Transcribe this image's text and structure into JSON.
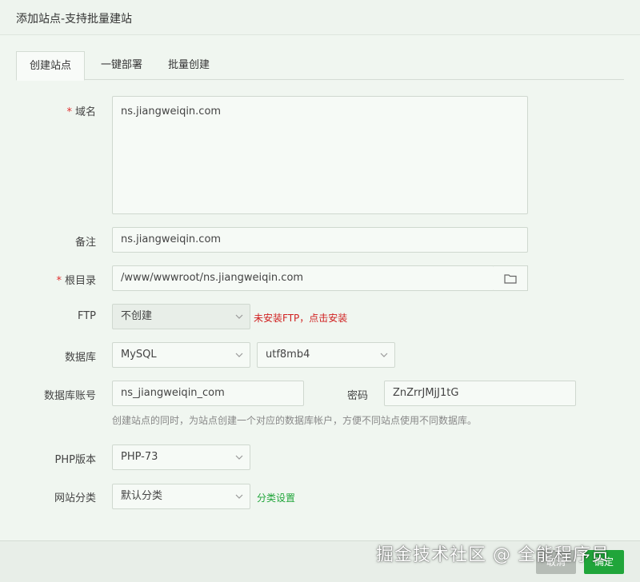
{
  "dialog": {
    "title": "添加站点-支持批量建站"
  },
  "tabs": [
    {
      "label": "创建站点",
      "active": true
    },
    {
      "label": "一键部署",
      "active": false
    },
    {
      "label": "批量创建",
      "active": false
    }
  ],
  "form": {
    "domain": {
      "label": "域名",
      "required": true,
      "value": "ns.jiangweiqin.com"
    },
    "remark": {
      "label": "备注",
      "value": "ns.jiangweiqin.com"
    },
    "root": {
      "label": "根目录",
      "required": true,
      "value": "/www/wwwroot/ns.jiangweiqin.com",
      "button_icon": "folder-icon"
    },
    "ftp": {
      "label": "FTP",
      "selected": "不创建",
      "link": "未安装FTP，点击安装"
    },
    "database": {
      "label": "数据库",
      "type": "MySQL",
      "charset": "utf8mb4"
    },
    "db_account": {
      "label": "数据库账号",
      "value": "ns_jiangweiqin_com"
    },
    "db_password": {
      "label": "密码",
      "value": "ZnZrrJMjJ1tG"
    },
    "db_hint": "创建站点的同时，为站点创建一个对应的数据库帐户，方便不同站点使用不同数据库。",
    "php": {
      "label": "PHP版本",
      "selected": "PHP-73"
    },
    "category": {
      "label": "网站分类",
      "selected": "默认分类",
      "link": "分类设置"
    }
  },
  "footer": {
    "cancel_label": "取消",
    "ok_label": "确定"
  },
  "watermark": "掘金技术社区 @ 全能程序员",
  "colors": {
    "accent": "#20a53a",
    "warning": "#d02020",
    "required": "#e03030"
  }
}
